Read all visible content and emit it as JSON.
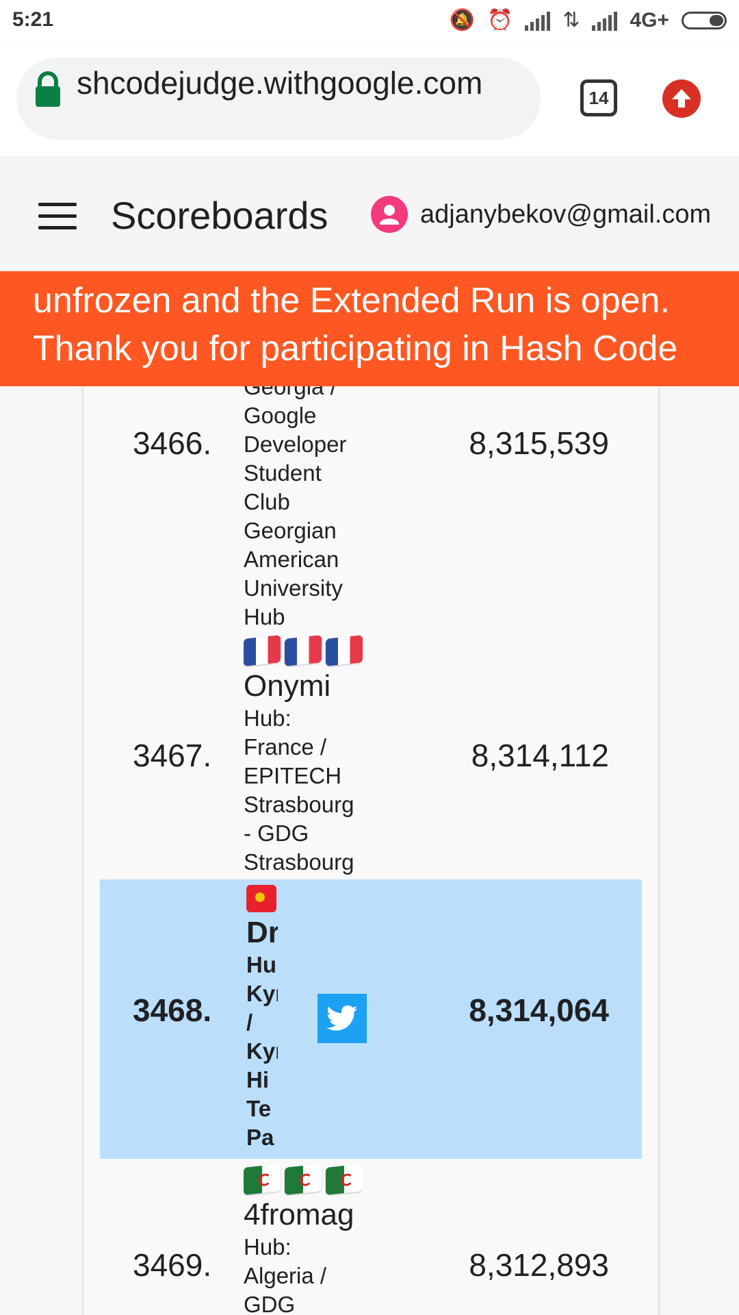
{
  "status_bar": {
    "time": "5:21",
    "network": "4G+",
    "icons": [
      "mute-icon",
      "alarm-icon",
      "signal-icon",
      "data-arrows-icon",
      "signal-icon",
      "battery-icon"
    ]
  },
  "browser": {
    "url": "shcodejudge.withgoogle.com",
    "tab_count": "14",
    "colors": {
      "lock": "#0b8043",
      "update": "#d93025"
    }
  },
  "header": {
    "title": "Scoreboards",
    "user_email": "adjanybekov@gmail.com"
  },
  "banner": {
    "text": "unfrozen and the Extended Run is open. Thank you for participating in Hash Code",
    "color": "#ff5722"
  },
  "scoreboard": {
    "rows": [
      {
        "rank": "3466.",
        "hub_lines": [
          "Georgia /",
          "Google",
          "Developer",
          "Student",
          "Club",
          "Georgian",
          "American",
          "University",
          "Hub"
        ],
        "score": "8,315,539"
      },
      {
        "rank": "3467.",
        "team": "Onymi",
        "hub_lines": [
          "Hub:",
          "France /",
          "EPITECH",
          "Strasbourg",
          "- GDG",
          "Strasbourg"
        ],
        "score": "8,314,112"
      },
      {
        "rank": "3468.",
        "team": "Dr",
        "hub_lines": [
          "Hu",
          "Kyı",
          "/",
          "Kyı",
          "Hi",
          "Te",
          "Pa"
        ],
        "score": "8,314,064",
        "highlight_color": "#bbdefb"
      },
      {
        "rank": "3469.",
        "team": "4fromag",
        "hub_lines": [
          "Hub:",
          "Algeria /",
          "GDG"
        ],
        "score": "8,312,893"
      }
    ]
  }
}
